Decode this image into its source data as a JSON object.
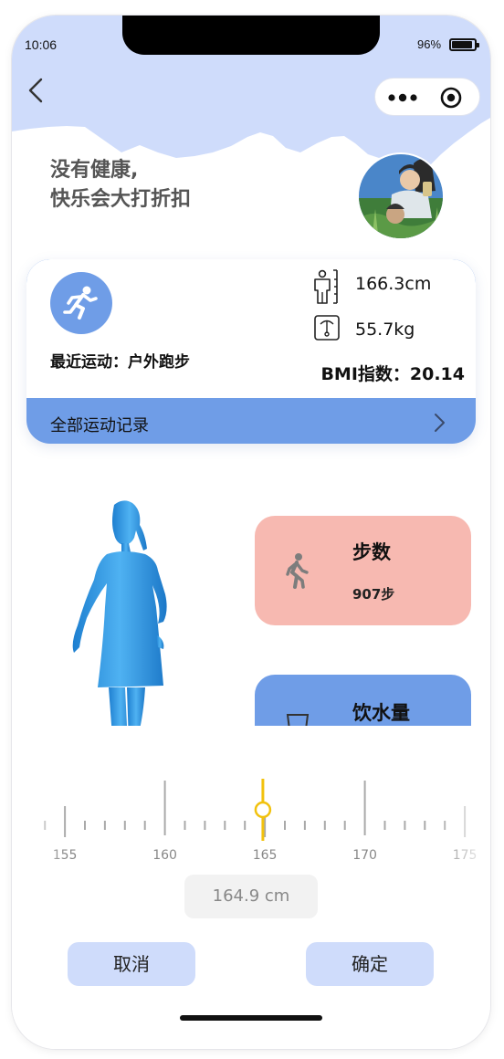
{
  "status_bar": {
    "time": "10:06",
    "battery": "96%"
  },
  "header": {
    "slogan_line1": "没有健康,",
    "slogan_line2": "快乐会大打折扣"
  },
  "summary": {
    "recent_activity": "最近运动：户外跑步",
    "height": "166.3cm",
    "weight": "55.7kg",
    "bmi": "BMI指数：20.14",
    "all_records_label": "全部运动记录"
  },
  "tiles": {
    "steps": {
      "title": "步数",
      "value": "907步"
    },
    "water": {
      "title": "饮水量"
    }
  },
  "ruler": {
    "labels": [
      "155",
      "160",
      "165",
      "170",
      "175"
    ],
    "min": 154,
    "max": 175,
    "selected": 164.9,
    "display": "164.9 cm"
  },
  "actions": {
    "cancel": "取消",
    "confirm": "确定"
  },
  "colors": {
    "accent_blue": "#6f9de7",
    "header_blue": "#cfdcfb",
    "steps_pink": "#f7b9b1",
    "ruler_pointer": "#f2c20e",
    "figure_blue": "#3fa3ea"
  },
  "icons": [
    "back-icon",
    "more-icon",
    "target-icon",
    "run-icon",
    "height-icon",
    "scale-icon",
    "chevron-right-icon",
    "walk-icon",
    "cup-icon"
  ]
}
